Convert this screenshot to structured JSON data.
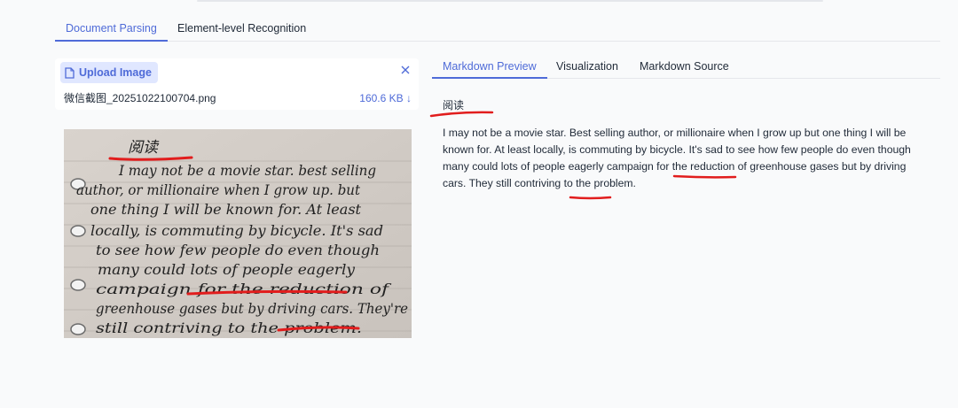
{
  "tabs": {
    "document_parsing": "Document Parsing",
    "element_recognition": "Element-level Recognition"
  },
  "upload": {
    "button_label": "Upload Image",
    "file_name": "微信截图_20251022100704.png",
    "file_size": "160.6 KB",
    "download_glyph": "↓"
  },
  "preview_tabs": {
    "markdown_preview": "Markdown Preview",
    "visualization": "Visualization",
    "markdown_source": "Markdown Source"
  },
  "content": {
    "heading": "阅读",
    "para_part1": "I may not be a movie star. Best selling author, or millionaire when I grow up but one thing I will be known for. At least locally, is commuting by bicycle. It's sad to see how few people do even though many could lots of people eagerly campaign for ",
    "para_reduction": "the reduction",
    "para_part2": " of greenhouse gases but by driving cars. They still contriving to the ",
    "para_problem": "problem",
    "para_end": "."
  },
  "image": {
    "handwriting_lines": [
      "阅读",
      "I may not be a movie star. best selling",
      "author, or millionaire when I grow up. but",
      "one thing I will be known for. At least",
      "locally, is commuting by bicycle. It's sad",
      "to see how few people do even though",
      "many could lots of people eagerly",
      "campaign for the reduction of",
      "greenhouse gases but by driving cars. They're",
      "still contriving to the problem."
    ]
  },
  "colors": {
    "accent": "#4f6bd8",
    "annotation_red": "#e11d1d"
  },
  "icons": [
    "file-icon",
    "close-icon",
    "download-arrow-icon"
  ]
}
